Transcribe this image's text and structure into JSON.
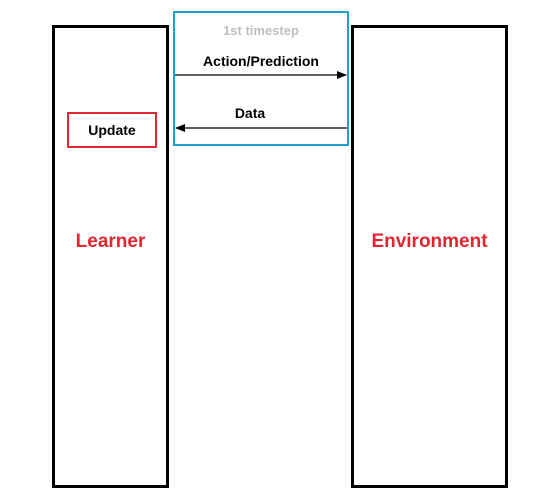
{
  "diagram": {
    "timestep_label": "1st timestep",
    "arrow_forward_label": "Action/Prediction",
    "arrow_back_label": "Data",
    "update_label": "Update",
    "learner_label": "Learner",
    "environment_label": "Environment"
  },
  "colors": {
    "timestep_border": "#1e9fd8",
    "timestep_text": "#bfbfbf",
    "update_border": "#e0262f",
    "entity_label": "#e0262f"
  }
}
